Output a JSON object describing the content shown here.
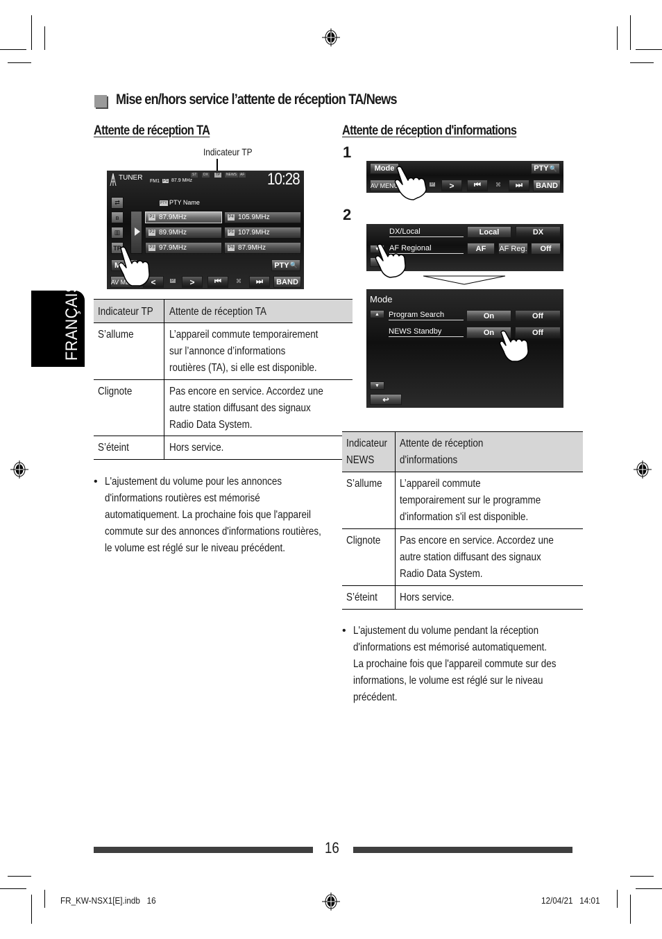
{
  "section": {
    "title": "Mise en/hors service l’attente de réception TA/News"
  },
  "language_tab": "FRANÇAIS",
  "left": {
    "subtitle": "Attente de réception TA",
    "callout": "Indicateur TP",
    "tuner_screen": {
      "source": "TUNER",
      "band_info": "FM1",
      "preset_badge": "P1",
      "frequency": "87.9 MHz",
      "indicators": [
        "ST",
        "DX",
        "TP",
        "NEWS",
        "AF"
      ],
      "active_indicator": "TP",
      "clock": "10:28",
      "pty_badge": "PTY",
      "pty_name": "PTY Name",
      "presets": [
        {
          "badge": "P1",
          "freq": "87.9MHz",
          "selected": true
        },
        {
          "badge": "P4",
          "freq": "105.9MHz",
          "selected": false
        },
        {
          "badge": "P2",
          "freq": "89.9MHz",
          "selected": false
        },
        {
          "badge": "P5",
          "freq": "107.9MHz",
          "selected": false
        },
        {
          "badge": "P3",
          "freq": "97.9MHz",
          "selected": false
        },
        {
          "badge": "P6",
          "freq": "87.9MHz",
          "selected": false
        }
      ],
      "side_buttons": [
        "source-switch",
        "bluetooth",
        "equalizer",
        "TP"
      ],
      "mode_button": "Mode",
      "pty_button": "PTY",
      "bottom_bar": {
        "av_menu": "AV MENU",
        "prev": "<",
        "p": "P",
        "next": ">",
        "skip_back": "|<<",
        "scan": "scan",
        "skip_fwd": ">>|",
        "band": "BAND"
      }
    },
    "table": {
      "headers": [
        "Indicateur TP",
        "Attente de réception TA"
      ],
      "rows": [
        {
          "state": "S’allume",
          "desc": [
            "L’appareil commute temporairement",
            "sur l’annonce d’informations",
            "routières (TA), si elle est disponible."
          ]
        },
        {
          "state": "Clignote",
          "desc": [
            "Pas encore en service. Accordez une",
            "autre station diffusant des signaux",
            "Radio Data System."
          ]
        },
        {
          "state": "S’éteint",
          "desc": [
            "Hors service."
          ]
        }
      ]
    },
    "note": {
      "bullet": "•",
      "lines": [
        "L'ajustement du volume pour les annonces",
        "d'informations routières est mémorisé",
        "automatiquement. La prochaine fois que l'appareil",
        "commute sur des annonces d'informations routières,",
        "le volume est réglé sur le niveau précédent."
      ]
    }
  },
  "right": {
    "subtitle": "Attente de réception d'informations",
    "step1": {
      "number": "1",
      "mode": "Mode",
      "pty": "PTY",
      "av_menu": "AV MENU",
      "p": "P",
      "next": ">",
      "skip_back": "|<<",
      "skip_fwd": ">>|",
      "band": "BAND"
    },
    "step2": {
      "number": "2",
      "screen_a": {
        "row1": {
          "label": "DX/Local",
          "options": [
            "Local",
            "DX"
          ]
        },
        "row2": {
          "label": "AF Regional",
          "options": [
            "AF",
            "AF Reg.",
            "Off"
          ]
        }
      },
      "screen_b": {
        "title": "Mode",
        "row1": {
          "label": "Program Search",
          "options": [
            "On",
            "Off"
          ]
        },
        "row2": {
          "label": "NEWS Standby",
          "options": [
            "On",
            "Off"
          ]
        },
        "back": "↩"
      }
    },
    "table": {
      "headers": [
        [
          "Indicateur",
          "NEWS"
        ],
        [
          "Attente de réception",
          "d'informations"
        ]
      ],
      "rows": [
        {
          "state": "S’allume",
          "desc": [
            "L’appareil commute",
            "temporairement sur le programme",
            "d'information s'il est disponible."
          ]
        },
        {
          "state": "Clignote",
          "desc": [
            "Pas encore en service. Accordez une",
            "autre station diffusant des signaux",
            "Radio Data System."
          ]
        },
        {
          "state": "S’éteint",
          "desc": [
            "Hors service."
          ]
        }
      ]
    },
    "note": {
      "bullet": "•",
      "lines": [
        "L'ajustement du volume pendant la réception",
        "d'informations est mémorisé automatiquement.",
        "La prochaine fois que l'appareil commute sur des",
        "informations, le volume est réglé sur le niveau",
        "précédent."
      ]
    }
  },
  "footer": {
    "page_number": "16",
    "file_slug": "FR_KW-NSX1[E].indb   16",
    "date_slug": "12/04/21   14:01"
  }
}
